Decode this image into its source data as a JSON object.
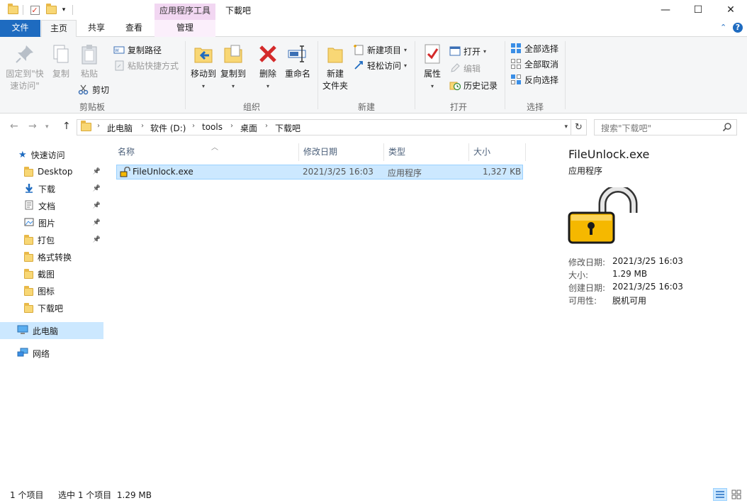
{
  "titlebar": {
    "context_tab": "应用程序工具",
    "title": "下載吧",
    "minimize": "—",
    "maximize": "☐",
    "close": "✕"
  },
  "tabs": {
    "file": "文件",
    "home": "主页",
    "share": "共享",
    "view": "查看",
    "manage": "管理"
  },
  "ribbon": {
    "clipboard": {
      "label": "剪贴板",
      "pin": "固定到\"快\n速访问\"",
      "copy": "复制",
      "paste": "粘贴",
      "copy_path": "复制路径",
      "paste_shortcut": "粘贴快捷方式",
      "cut": "剪切"
    },
    "organize": {
      "label": "组织",
      "move_to": "移动到",
      "copy_to": "复制到",
      "delete": "删除",
      "rename": "重命名"
    },
    "new": {
      "label": "新建",
      "new_folder": "新建\n文件夹",
      "new_item": "新建项目",
      "easy_access": "轻松访问"
    },
    "open": {
      "label": "打开",
      "properties": "属性",
      "open": "打开",
      "edit": "编辑",
      "history": "历史记录"
    },
    "select": {
      "label": "选择",
      "select_all": "全部选择",
      "select_none": "全部取消",
      "invert": "反向选择"
    }
  },
  "address": {
    "crumbs": [
      "此电脑",
      "软件 (D:)",
      "tools",
      "桌面",
      "下载吧"
    ],
    "search_placeholder": "搜索\"下载吧\""
  },
  "nav": {
    "quick_access": "快速访问",
    "items": [
      {
        "label": "Desktop",
        "pinned": true
      },
      {
        "label": "下载",
        "pinned": true
      },
      {
        "label": "文档",
        "pinned": true
      },
      {
        "label": "图片",
        "pinned": true
      },
      {
        "label": "打包",
        "pinned": true
      },
      {
        "label": "格式转换",
        "pinned": false
      },
      {
        "label": "截图",
        "pinned": false
      },
      {
        "label": "图标",
        "pinned": false
      },
      {
        "label": "下载吧",
        "pinned": false
      }
    ],
    "this_pc": "此电脑",
    "network": "网络"
  },
  "filelist": {
    "columns": [
      "名称",
      "修改日期",
      "类型",
      "大小"
    ],
    "rows": [
      {
        "name": "FileUnlock.exe",
        "date": "2021/3/25 16:03",
        "type": "应用程序",
        "size": "1,327 KB"
      }
    ]
  },
  "details": {
    "name": "FileUnlock.exe",
    "type": "应用程序",
    "props": [
      {
        "k": "修改日期:",
        "v": "2021/3/25 16:03"
      },
      {
        "k": "大小:",
        "v": "1.29 MB"
      },
      {
        "k": "创建日期:",
        "v": "2021/3/25 16:03"
      },
      {
        "k": "可用性:",
        "v": "脱机可用"
      }
    ]
  },
  "status": {
    "count": "1 个项目",
    "selected": "选中 1 个项目  1.29 MB"
  },
  "colors": {
    "accent": "#1e6bc0",
    "selection": "#cce8ff",
    "context_tab": "#f2d7f2"
  }
}
